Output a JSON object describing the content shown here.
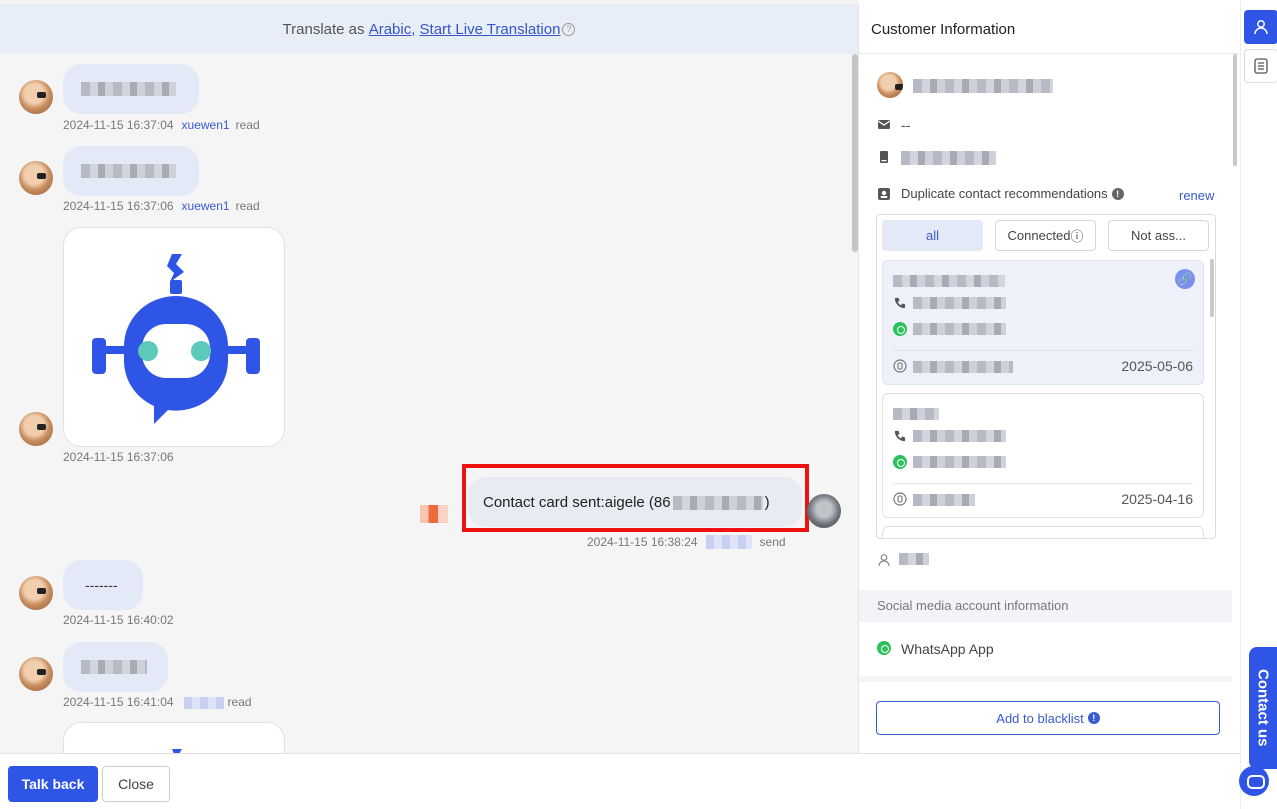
{
  "translate_bar": {
    "prefix": "Translate as",
    "language_link": "Arabic,",
    "live_link": "Start Live Translation",
    "help_icon": "question-icon"
  },
  "messages": [
    {
      "timestamp": "2024-11-15 16:37:04",
      "agent": "xuewen1",
      "status": "read"
    },
    {
      "timestamp": "2024-11-15 16:37:06",
      "agent": "xuewen1",
      "status": "read"
    },
    {
      "timestamp": "2024-11-15 16:37:06",
      "type": "image",
      "image_icon": "robot-logo-icon"
    },
    {
      "text_prefix": "Contact card sent:aigele (86",
      "text_suffix": ")",
      "timestamp": "2024-11-15 16:38:24",
      "status": "send",
      "direction": "outgoing"
    },
    {
      "text": "-------",
      "timestamp": "2024-11-15 16:40:02"
    },
    {
      "timestamp": "2024-11-15 16:41:04",
      "status": "read"
    }
  ],
  "bottom_bar": {
    "talk_back": "Talk back",
    "close": "Close"
  },
  "customer_panel": {
    "title": "Customer Information",
    "email": "--",
    "duplicate_label": "Duplicate contact recommendations",
    "renew": "renew",
    "tabs": [
      "all",
      "Connected",
      "Not ass..."
    ],
    "tab_connected_suffix": "ⓘ",
    "cards": [
      {
        "date": "2025-05-06",
        "selected": true
      },
      {
        "date": "2025-04-16",
        "selected": false
      }
    ],
    "social_section": "Social media account information",
    "whatsapp_app": "WhatsApp App",
    "blacklist_button": "Add to blacklist"
  },
  "right_rail": {
    "contact_us": "Contact us",
    "icons": [
      "user-icon",
      "document-icon",
      "chat-bubble-icon"
    ]
  },
  "colors": {
    "primary": "#2f55e6",
    "link": "#3a5bd0",
    "bubble": "#e3e9f7",
    "highlight_box": "#ee1111",
    "whatsapp": "#2bc25b"
  }
}
